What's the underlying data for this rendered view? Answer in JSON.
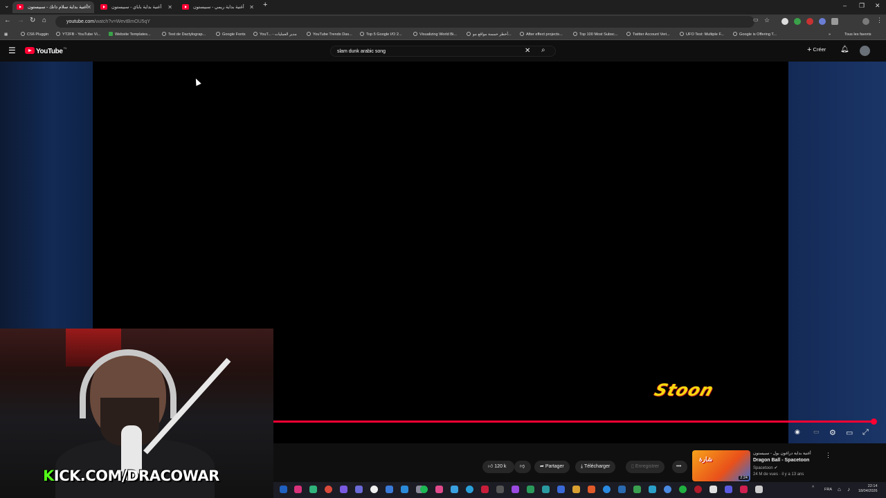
{
  "browser": {
    "tabs": [
      {
        "title": "أغنية بداية سلام دانك - سبيستون",
        "active": true
      },
      {
        "title": "أغنية بداية باباي - سبيستون",
        "active": false
      },
      {
        "title": "أغنية بداية ريمي - سبيستون",
        "active": false
      }
    ],
    "new_tab_label": "+",
    "url_domain": "youtube.com",
    "url_path": "/watch?v=WevtBmOU5qY",
    "bookmarks": [
      "CS6 Pluggin",
      "YT2FB - YouTube Vi...",
      "Website Templates...",
      "Test de Dactylograp...",
      "Google Fonts",
      "YouT... - مدير العمليات",
      "YouTube Trends Das...",
      "Top 5 Google I/O 2...",
      "Visualizing World Bi...",
      "أخطر خمسة مواقع مو...",
      "After effect projects...",
      "Top 100 Most Subsc...",
      "Twitter Account Veri...",
      "UFO Test: Multiple F...",
      "Google is Offering T..."
    ],
    "all_bookmarks_label": "Tous les favoris"
  },
  "youtube": {
    "logo_text": "YouTube",
    "logo_region": "TN",
    "search_value": "slam dunk arabic song",
    "create_label": "Créer"
  },
  "player": {
    "watermark": "Stoon",
    "progress_fraction": 0.99
  },
  "actions": {
    "likes": "120 k",
    "share": "Partager",
    "download": "Télécharger",
    "save": "Enregistrer"
  },
  "suggestion": {
    "title_ar": "أغنية بداية دراغون بول - سبيستون",
    "title": "Dragon Ball - Spacetoon",
    "channel": "Spacetoon",
    "meta": "24 M de vues · il y a 13 ans",
    "duration": "2:24",
    "thumb_text": "شارة"
  },
  "overlay": {
    "kick_k": "K",
    "kick_rest": "ICK.COM/DRACOWAR"
  },
  "taskbar": {
    "lang": "FRA",
    "time": "22:14",
    "date": "18/04/2026"
  },
  "colors": {
    "youtube_red": "#ff0033",
    "kick_green": "#53fc18",
    "stoon_yellow": "#f5d90e"
  }
}
